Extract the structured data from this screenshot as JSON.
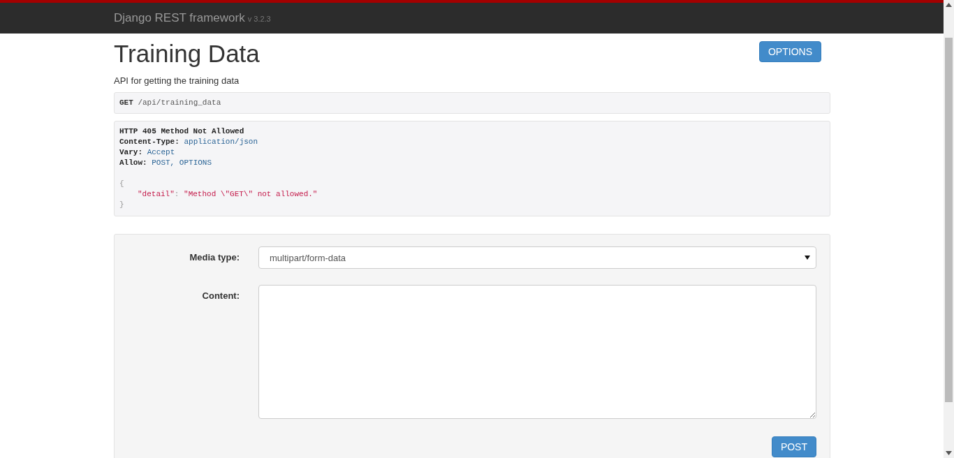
{
  "navbar": {
    "brand": "Django REST framework",
    "version": "v 3.2.3"
  },
  "heading": "Training Data",
  "description": "API for getting the training data",
  "options_button": "OPTIONS",
  "request": {
    "method": "GET",
    "path": "/api/training_data"
  },
  "response": {
    "status": "HTTP 405 Method Not Allowed",
    "headers": [
      {
        "name": "Content-Type:",
        "value": "application/json"
      },
      {
        "name": "Vary:",
        "value": "Accept"
      },
      {
        "name": "Allow:",
        "value": "POST, OPTIONS"
      }
    ],
    "body": {
      "open": "{",
      "key": "\"detail\"",
      "separator": ":",
      "value": "\"Method \\\"GET\\\" not allowed.\"",
      "close": "}"
    }
  },
  "form": {
    "media_type": {
      "label": "Media type:",
      "value": "multipart/form-data"
    },
    "content": {
      "label": "Content:"
    },
    "submit": "POST"
  }
}
